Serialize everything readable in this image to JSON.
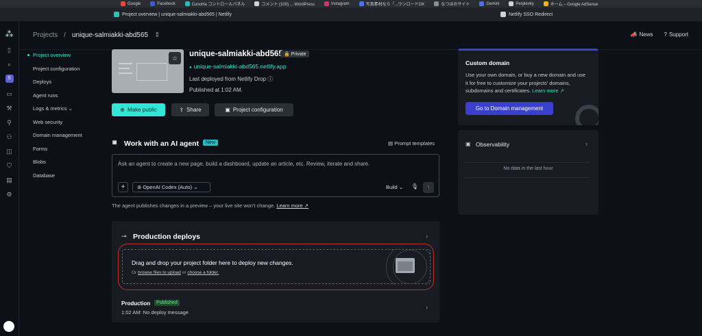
{
  "bookmarks": [
    {
      "label": "Google",
      "color": "#e8453c"
    },
    {
      "label": "Facebook",
      "color": "#3b5bdb"
    },
    {
      "label": "ConoHa コントロールパネル",
      "color": "#2bb8c4"
    },
    {
      "label": "コメント (100) ... WordPress",
      "color": "#cfd2d6"
    },
    {
      "label": "Instagram",
      "color": "#d6336c"
    },
    {
      "label": "写真素材なら「...ウンロードOK",
      "color": "#4c6ef5"
    },
    {
      "label": "なつほのサイト",
      "color": "#868e96"
    },
    {
      "label": "Gemini",
      "color": "#4c6ef5"
    },
    {
      "label": "Perplexity",
      "color": "#cfd2d6"
    },
    {
      "label": "ホーム – Google AdSense",
      "color": "#fab005"
    }
  ],
  "tabs": {
    "active": "Project overview | unique-salmiakki-abd565 | Netlify",
    "other": "Netlify SSO Redirect"
  },
  "breadcrumb": {
    "root": "Projects",
    "sep": "/",
    "current": "unique-salmiakki-abd565"
  },
  "top_links": {
    "news": "News",
    "support": "Support"
  },
  "nav": [
    "Project overview",
    "Project configuration",
    "Deploys",
    "Agent runs",
    "Logs & metrics ⌄",
    "Web security",
    "Domain management",
    "Forms",
    "Blobs",
    "Database"
  ],
  "site": {
    "name": "unique-salmiakki-abd565",
    "visibility": "Private",
    "url": "unique-salmiakki-abd565.netlify.app",
    "deployed_from": "Last deployed from Netlify Drop",
    "published": "Published at 1:02 AM."
  },
  "buttons": {
    "make_public": "Make public",
    "share": "Share",
    "project_configuration": "Project configuration"
  },
  "ai": {
    "title": "Work with an AI agent",
    "badge": "New",
    "prompt_templates": "Prompt templates",
    "placeholder": "Ask an agent to create a new page, build a dashboard, update an article, etc. Review, iterate and share.",
    "model": "OpenAI Codex",
    "model_suffix": "(Auto)",
    "mode": "Build",
    "note": "The agent publishes changes in a preview – your live site won't change.",
    "learn_more": "Learn more ↗"
  },
  "deploys": {
    "title": "Production deploys",
    "drop_title": "Drag and drop your project folder here to deploy new changes.",
    "drop_or": "Or",
    "browse": "browse files to upload",
    "or": "or",
    "choose": "choose a folder.",
    "production_label": "Production",
    "production_status": "Published",
    "production_msg": "1:02 AM: No deploy message"
  },
  "domain": {
    "title": "Custom domain",
    "text": "Use your own domain, or buy a new domain and use it for free to customize your projects' domains, subdomains and certificates.",
    "learn_more": "Learn more ↗",
    "button": "Go to Domain management"
  },
  "observability": {
    "title": "Observability",
    "empty": "No data in the last hour"
  },
  "colors": {
    "accent": "#32e6d6",
    "domain_button": "#3b3fce",
    "drop_outline": "#c0302a"
  }
}
